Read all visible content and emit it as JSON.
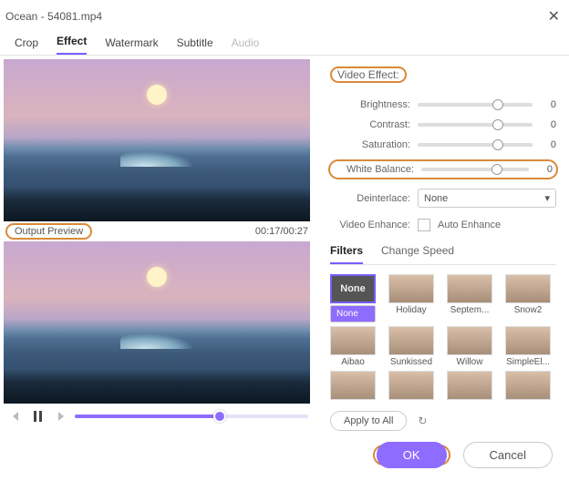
{
  "window_title": "Ocean - 54081.mp4",
  "tabs": [
    "Crop",
    "Effect",
    "Watermark",
    "Subtitle",
    "Audio"
  ],
  "active_tab": "Effect",
  "disabled_tab": "Audio",
  "preview_label": "Output Preview",
  "time_display": "00:17/00:27",
  "video_effect_label": "Video Effect:",
  "sliders": {
    "brightness": {
      "label": "Brightness:",
      "value": 0,
      "pos": 70
    },
    "contrast": {
      "label": "Contrast:",
      "value": 0,
      "pos": 70
    },
    "saturation": {
      "label": "Saturation:",
      "value": 0,
      "pos": 70
    },
    "white_balance": {
      "label": "White Balance:",
      "value": 0,
      "pos": 70
    }
  },
  "deinterlace": {
    "label": "Deinterlace:",
    "value": "None"
  },
  "video_enhance": {
    "label": "Video Enhance:",
    "checkbox": "Auto Enhance"
  },
  "subtabs": [
    "Filters",
    "Change Speed"
  ],
  "active_subtab": "Filters",
  "filters": [
    {
      "name": "None",
      "selected": true
    },
    {
      "name": "Holiday"
    },
    {
      "name": "Septem..."
    },
    {
      "name": "Snow2"
    },
    {
      "name": "Aibao"
    },
    {
      "name": "Sunkissed"
    },
    {
      "name": "Willow"
    },
    {
      "name": "SimpleEl..."
    },
    {
      "name": ""
    },
    {
      "name": ""
    },
    {
      "name": ""
    },
    {
      "name": ""
    }
  ],
  "apply_all": "Apply to All",
  "ok": "OK",
  "cancel": "Cancel"
}
